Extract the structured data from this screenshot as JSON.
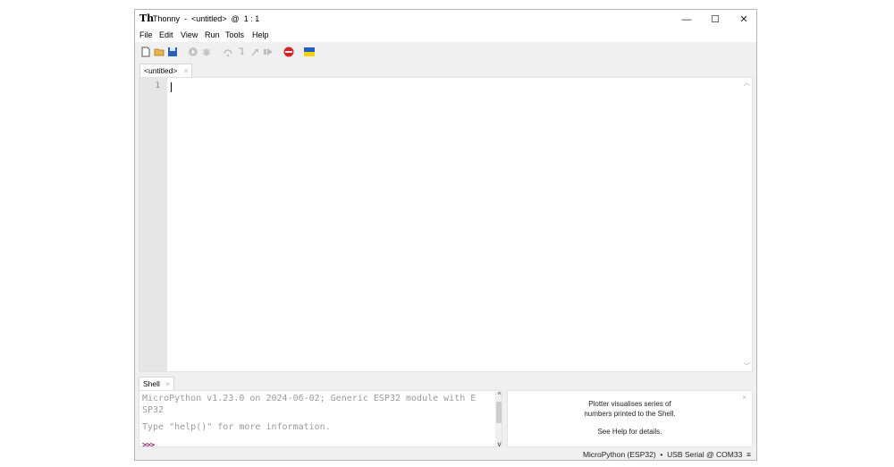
{
  "window": {
    "app_logo": "Th",
    "title": "Thonny  -  <untitled>  @  1 : 1",
    "minimize_glyph": "—",
    "maximize_glyph": "☐",
    "close_glyph": "✕"
  },
  "menu": [
    "File",
    "Edit",
    "View",
    "Run",
    "Tools",
    "Help"
  ],
  "toolbar": {
    "icons": [
      "new-file-icon",
      "open-file-icon",
      "save-icon",
      "run-icon",
      "debug-icon",
      "step-over-icon",
      "step-into-icon",
      "step-out-icon",
      "resume-icon",
      "stop-icon",
      "ukraine-flag-icon"
    ],
    "colors": {
      "stop": "#d62424",
      "flag_blue": "#1f5fbf",
      "flag_yellow": "#f5d20c",
      "disabled": "#b8b8b8"
    }
  },
  "editor": {
    "tab_label": "<untitled>",
    "tab_close": "×",
    "line_number": "1"
  },
  "shell": {
    "tab_label": "Shell",
    "tab_close": "×",
    "lines": [
      "MicroPython v1.23.0 on 2024-06-02; Generic ESP32 module with E",
      "SP32",
      "Type \"help()\" for more information."
    ],
    "prompt": ">>>"
  },
  "plotter": {
    "line1": "Plotter visualises series of",
    "line2": "numbers printed to the Shell.",
    "line3": "See Help for details.",
    "close": "×"
  },
  "status": {
    "text": "MicroPython (ESP32)  •  USB Serial @ COM33  ≡"
  }
}
